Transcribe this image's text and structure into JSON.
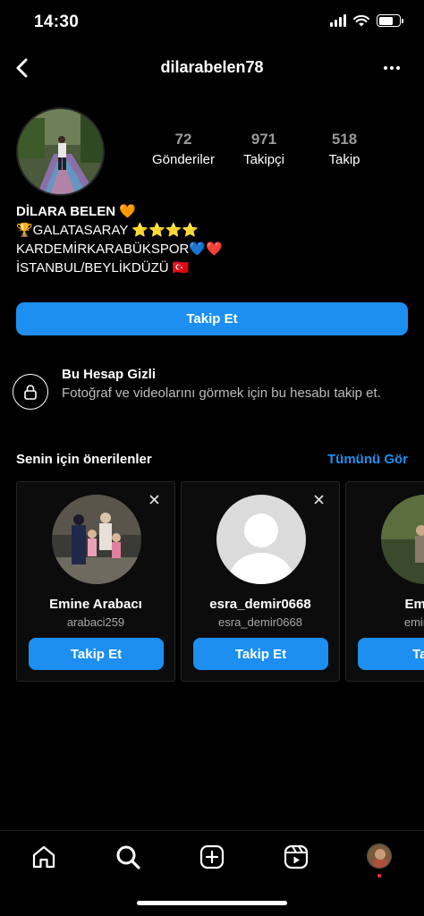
{
  "status": {
    "time": "14:30"
  },
  "header": {
    "username": "dilarabelen78"
  },
  "stats": [
    {
      "count": "72",
      "label": "Gönderiler"
    },
    {
      "count": "971",
      "label": "Takipçi"
    },
    {
      "count": "518",
      "label": "Takip"
    }
  ],
  "bio": {
    "name": "DİLARA BELEN 🧡",
    "lines": [
      "🏆GALATASARAY ⭐⭐⭐⭐",
      "KARDEMİRKARABÜKSPOR💙❤️",
      "İSTANBUL/BEYLİKDÜZÜ 🇹🇷"
    ]
  },
  "follow_button": "Takip Et",
  "private": {
    "title": "Bu Hesap Gizli",
    "description": "Fotoğraf ve videolarını görmek için bu hesabı takip et."
  },
  "suggestions": {
    "title": "Senin için önerilenler",
    "see_all": "Tümünü Gör",
    "cards": [
      {
        "name": "Emine Arabacı",
        "username": "arabaci259",
        "button": "Takip Et"
      },
      {
        "name": "esra_demir0668",
        "username": "esra_demir0668",
        "button": "Takip Et"
      },
      {
        "name": "Emine",
        "username": "eminetu",
        "button": "Taki"
      }
    ]
  },
  "nav": [
    "home-icon",
    "search-icon",
    "create-icon",
    "reels-icon",
    "profile-avatar"
  ],
  "colors": {
    "accent": "#1c8ff1",
    "background": "#000000",
    "notification": "#ff3040"
  }
}
